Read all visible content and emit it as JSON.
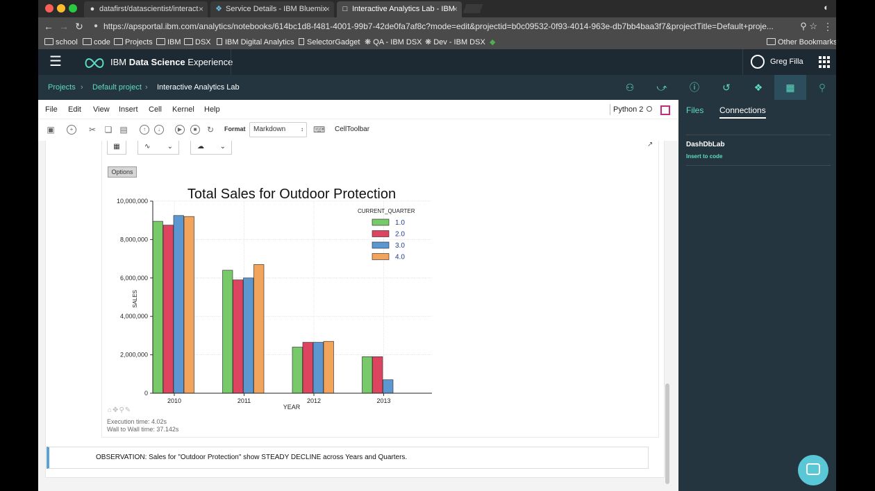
{
  "browser": {
    "tabs": [
      {
        "title": "datafirst/datascientist/interact",
        "icon": "github-icon"
      },
      {
        "title": "Service Details - IBM Bluemix",
        "icon": "bluemix-icon"
      },
      {
        "title": "Interactive Analytics Lab - IBM",
        "icon": "page-icon"
      }
    ],
    "url": "https://apsportal.ibm.com/analytics/notebooks/614bc1d8-f481-4001-99b7-42de0fa7af8c?mode=edit&projectid=b0c09532-0f93-4014-963e-db7bb4baa3f7&projectTitle=Default+proje...",
    "bookmarks": [
      "school",
      "code",
      "Projects",
      "IBM",
      "DSX",
      "IBM Digital Analytics",
      "SelectorGadget",
      "QA - IBM DSX",
      "Dev - IBM DSX"
    ],
    "other_bookmarks": "Other Bookmarks"
  },
  "header": {
    "brand_prefix": "IBM ",
    "brand_bold": "Data Science",
    "brand_suffix": " Experience",
    "user": "Greg Filla"
  },
  "breadcrumb": {
    "items": [
      "Projects",
      "Default project",
      "Interactive Analytics Lab"
    ]
  },
  "toolbar_icons": [
    "flask-icon",
    "share-icon",
    "info-icon",
    "versions-icon",
    "palette-icon",
    "data-icon",
    "search-icon"
  ],
  "notebook": {
    "menu": [
      "File",
      "Edit",
      "View",
      "Insert",
      "Cell",
      "Kernel",
      "Help"
    ],
    "kernel": "Python 2",
    "format_label": "Format",
    "format_value": "Markdown",
    "celltoolbar": "CellToolbar",
    "options_label": "Options",
    "exec_time": "Execution time: 4.02s",
    "wall_time": "Wall to Wall time: 37.142s",
    "markdown_text": "OBSERVATION: Sales for \"Outdoor Protection\" show STEADY DECLINE across Years and Quarters."
  },
  "side_panel": {
    "tabs": [
      "Files",
      "Connections"
    ],
    "active_tab": "Connections",
    "connection_name": "DashDbLab",
    "insert_label": "Insert to code"
  },
  "chart_data": {
    "type": "bar",
    "title": "Total Sales for Outdoor Protection",
    "xlabel": "YEAR",
    "ylabel": "SALES",
    "categories": [
      "2010",
      "2011",
      "2012",
      "2013"
    ],
    "legend_title": "CURRENT_QUARTER",
    "legend_position": "top-right",
    "ylim": [
      0,
      10000000
    ],
    "yticks": [
      "0",
      "2,000,000",
      "4,000,000",
      "6,000,000",
      "8,000,000",
      "10,000,000"
    ],
    "grid": true,
    "series": [
      {
        "name": "1.0",
        "color": "#77c96a",
        "values": [
          8950000,
          6400000,
          2400000,
          1900000
        ]
      },
      {
        "name": "2.0",
        "color": "#dd4460",
        "values": [
          8750000,
          5900000,
          2650000,
          1900000
        ]
      },
      {
        "name": "3.0",
        "color": "#5c97d0",
        "values": [
          9250000,
          6000000,
          2650000,
          700000
        ]
      },
      {
        "name": "4.0",
        "color": "#f3a45c",
        "values": [
          9200000,
          6700000,
          2700000,
          null
        ]
      }
    ]
  }
}
